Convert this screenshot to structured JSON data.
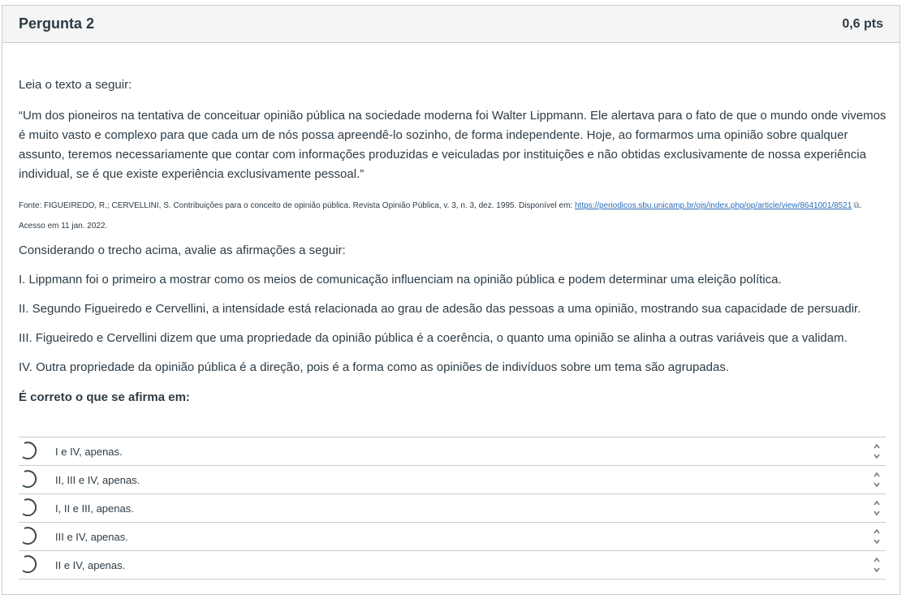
{
  "question": {
    "title": "Pergunta 2",
    "points": "0,6 pts",
    "intro": "Leia o texto a seguir:",
    "quote": "“Um dos pioneiros na tentativa de conceituar opinião pública na sociedade moderna foi Walter Lippmann. Ele alertava para o fato de que o mundo onde vivemos é muito vasto e complexo para que cada um de nós possa apreendê-lo sozinho, de forma independente. Hoje, ao formarmos uma opinião sobre qualquer assunto, teremos necessariamente que contar com informações produzidas e veiculadas por instituições e não obtidas exclusivamente de nossa experiência individual, se é que existe experiência exclusivamente pessoal.”",
    "source_prefix": "Fonte: FIGUEIREDO, R.; CERVELLINI, S. Contribuições para o conceito de opinião pública. Revista Opinião Pública, v. 3, n. 3, dez. 1995. Disponível em: ",
    "source_link": "https://periodicos.sbu.unicamp.br/ojs/index.php/op/article/view/8641001/8521",
    "source_suffix": ". Acesso em 11 jan. 2022.",
    "considering": "Considerando o trecho acima, avalie as afirmações a seguir:",
    "statements": [
      "I. Lippmann foi o primeiro a mostrar como os meios de comunicação influenciam na opinião pública e podem determinar uma eleição política.",
      "II. Segundo Figueiredo e Cervellini, a intensidade está relacionada ao grau de adesão das pessoas a uma opinião, mostrando sua capacidade de persuadir.",
      "III. Figueiredo e Cervellini dizem que uma propriedade da opinião pública é a coerência, o quanto uma opinião se alinha a outras variáveis que a validam.",
      "IV. Outra propriedade da opinião pública é a direção, pois é a forma como as opiniões de indivíduos sobre um tema são agrupadas."
    ],
    "prompt": "É correto o que se afirma em:",
    "answers": [
      "I e IV, apenas.",
      "II, III e IV, apenas.",
      "I, II e III, apenas.",
      "III e IV, apenas.",
      "II e IV, apenas."
    ]
  },
  "icons": {
    "external_link": "external-link-icon",
    "radio": "radio-loading-icon",
    "sort": "sort-arrows-icon"
  },
  "colors": {
    "link": "#2a6dba",
    "border": "#c7cdd1",
    "header_bg": "#f5f5f5",
    "text": "#2d3b45"
  }
}
